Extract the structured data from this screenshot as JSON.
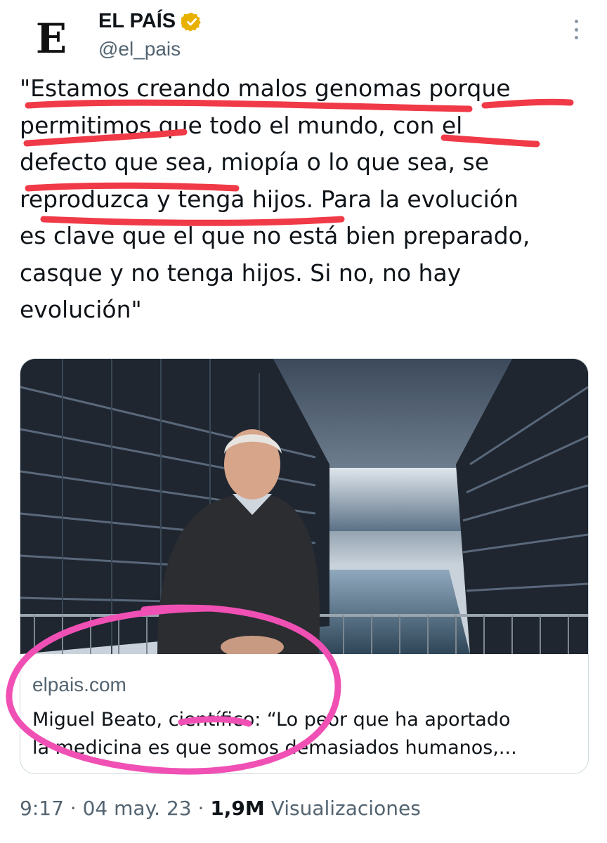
{
  "account": {
    "avatar_letter": "E",
    "display_name": "EL PAÍS",
    "handle": "@el_pais",
    "verified_icon": "verified-badge-gold"
  },
  "tweet": {
    "lines": [
      "\"Estamos creando malos genomas porque",
      "permitimos que todo el mundo, con el",
      "defecto que sea, miopía o lo que sea, se",
      "reproduzca y tenga hijos. Para la evolución",
      "es clave que el que no está bien preparado,",
      "casque y no tenga hijos. Si no, no hay",
      "evolución\""
    ]
  },
  "card": {
    "image_description_icon": "photo-man-balcony-sea",
    "domain": "elpais.com",
    "title_lines": [
      "Miguel Beato, científico: “Lo peor que ha aportado",
      "la medicina es que somos demasiados humanos,..."
    ]
  },
  "meta": {
    "time": "9:17",
    "date": "04 may. 23",
    "views_count": "1,9M",
    "views_label": "Visualizaciones",
    "separator": "·"
  },
  "colors": {
    "underline_red": "#f03a47",
    "circle_pink": "#f050b4",
    "verified_gold": "#e8b100"
  }
}
